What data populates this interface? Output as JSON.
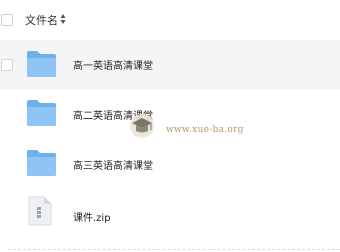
{
  "header": {
    "name_label": "文件名"
  },
  "rows": [
    {
      "label": "高一英语高清课堂",
      "type": "folder"
    },
    {
      "label": "高二英语高清课堂",
      "type": "folder"
    },
    {
      "label": "高三英语高清课堂",
      "type": "folder"
    },
    {
      "label": "课件.zip",
      "type": "zip"
    }
  ],
  "watermark": {
    "text": "www.xue-ba.org"
  },
  "colors": {
    "folder": "#7ab7ee",
    "folder_light": "#a8d3fb",
    "hover": "#f4f5f7",
    "watermark": "#b69a63"
  }
}
